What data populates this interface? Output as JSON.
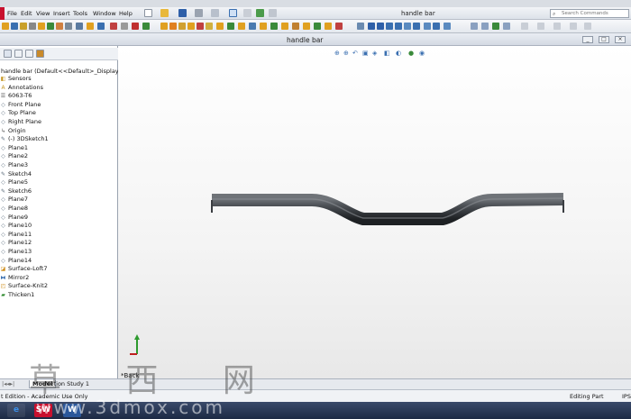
{
  "app": {
    "title": "handle bar",
    "menu": [
      "File",
      "Edit",
      "View",
      "Insert",
      "Tools",
      "Window",
      "Help"
    ],
    "search_placeholder": "Search Commands",
    "brand_color": "#c8102e"
  },
  "document": {
    "title": "handle bar",
    "window_buttons": [
      "_",
      "□",
      "×"
    ]
  },
  "feature_tree": {
    "root": "handle bar  (Default<<Default>_Display Stat",
    "items": [
      {
        "label": "Sensors",
        "icon": "sensor-icon"
      },
      {
        "label": "Annotations",
        "icon": "annotation-icon"
      },
      {
        "label": "6063-T6",
        "icon": "material-icon"
      },
      {
        "label": "Front Plane",
        "icon": "plane-icon"
      },
      {
        "label": "Top Plane",
        "icon": "plane-icon"
      },
      {
        "label": "Right Plane",
        "icon": "plane-icon"
      },
      {
        "label": "Origin",
        "icon": "origin-icon"
      },
      {
        "label": "(-) 3DSketch1",
        "icon": "sketch-icon"
      },
      {
        "label": "Plane1",
        "icon": "plane-icon"
      },
      {
        "label": "Plane2",
        "icon": "plane-icon"
      },
      {
        "label": "Plane3",
        "icon": "plane-icon"
      },
      {
        "label": "Sketch4",
        "icon": "sketch-icon"
      },
      {
        "label": "Plane5",
        "icon": "plane-icon"
      },
      {
        "label": "Sketch6",
        "icon": "sketch-icon"
      },
      {
        "label": "Plane7",
        "icon": "plane-icon"
      },
      {
        "label": "Plane8",
        "icon": "plane-icon"
      },
      {
        "label": "Plane9",
        "icon": "plane-icon"
      },
      {
        "label": "Plane10",
        "icon": "plane-icon"
      },
      {
        "label": "Plane11",
        "icon": "plane-icon"
      },
      {
        "label": "Plane12",
        "icon": "plane-icon"
      },
      {
        "label": "Plane13",
        "icon": "plane-icon"
      },
      {
        "label": "Plane14",
        "icon": "plane-icon"
      },
      {
        "label": "Surface-Loft7",
        "icon": "surface-icon"
      },
      {
        "label": "Mirror2",
        "icon": "mirror-icon"
      },
      {
        "label": "Surface-Knit2",
        "icon": "knit-icon"
      },
      {
        "label": "Thicken1",
        "icon": "thicken-icon"
      }
    ]
  },
  "viewport": {
    "view_label": "*Back"
  },
  "bottom_tabs": {
    "model": "Model",
    "motion": "Motion Study 1"
  },
  "status": {
    "left": "t Edition - Academic Use Only",
    "right": "Editing Part",
    "units": "IPS"
  },
  "watermark": {
    "text": "草 西 网",
    "url": "www.3dmox.com"
  }
}
